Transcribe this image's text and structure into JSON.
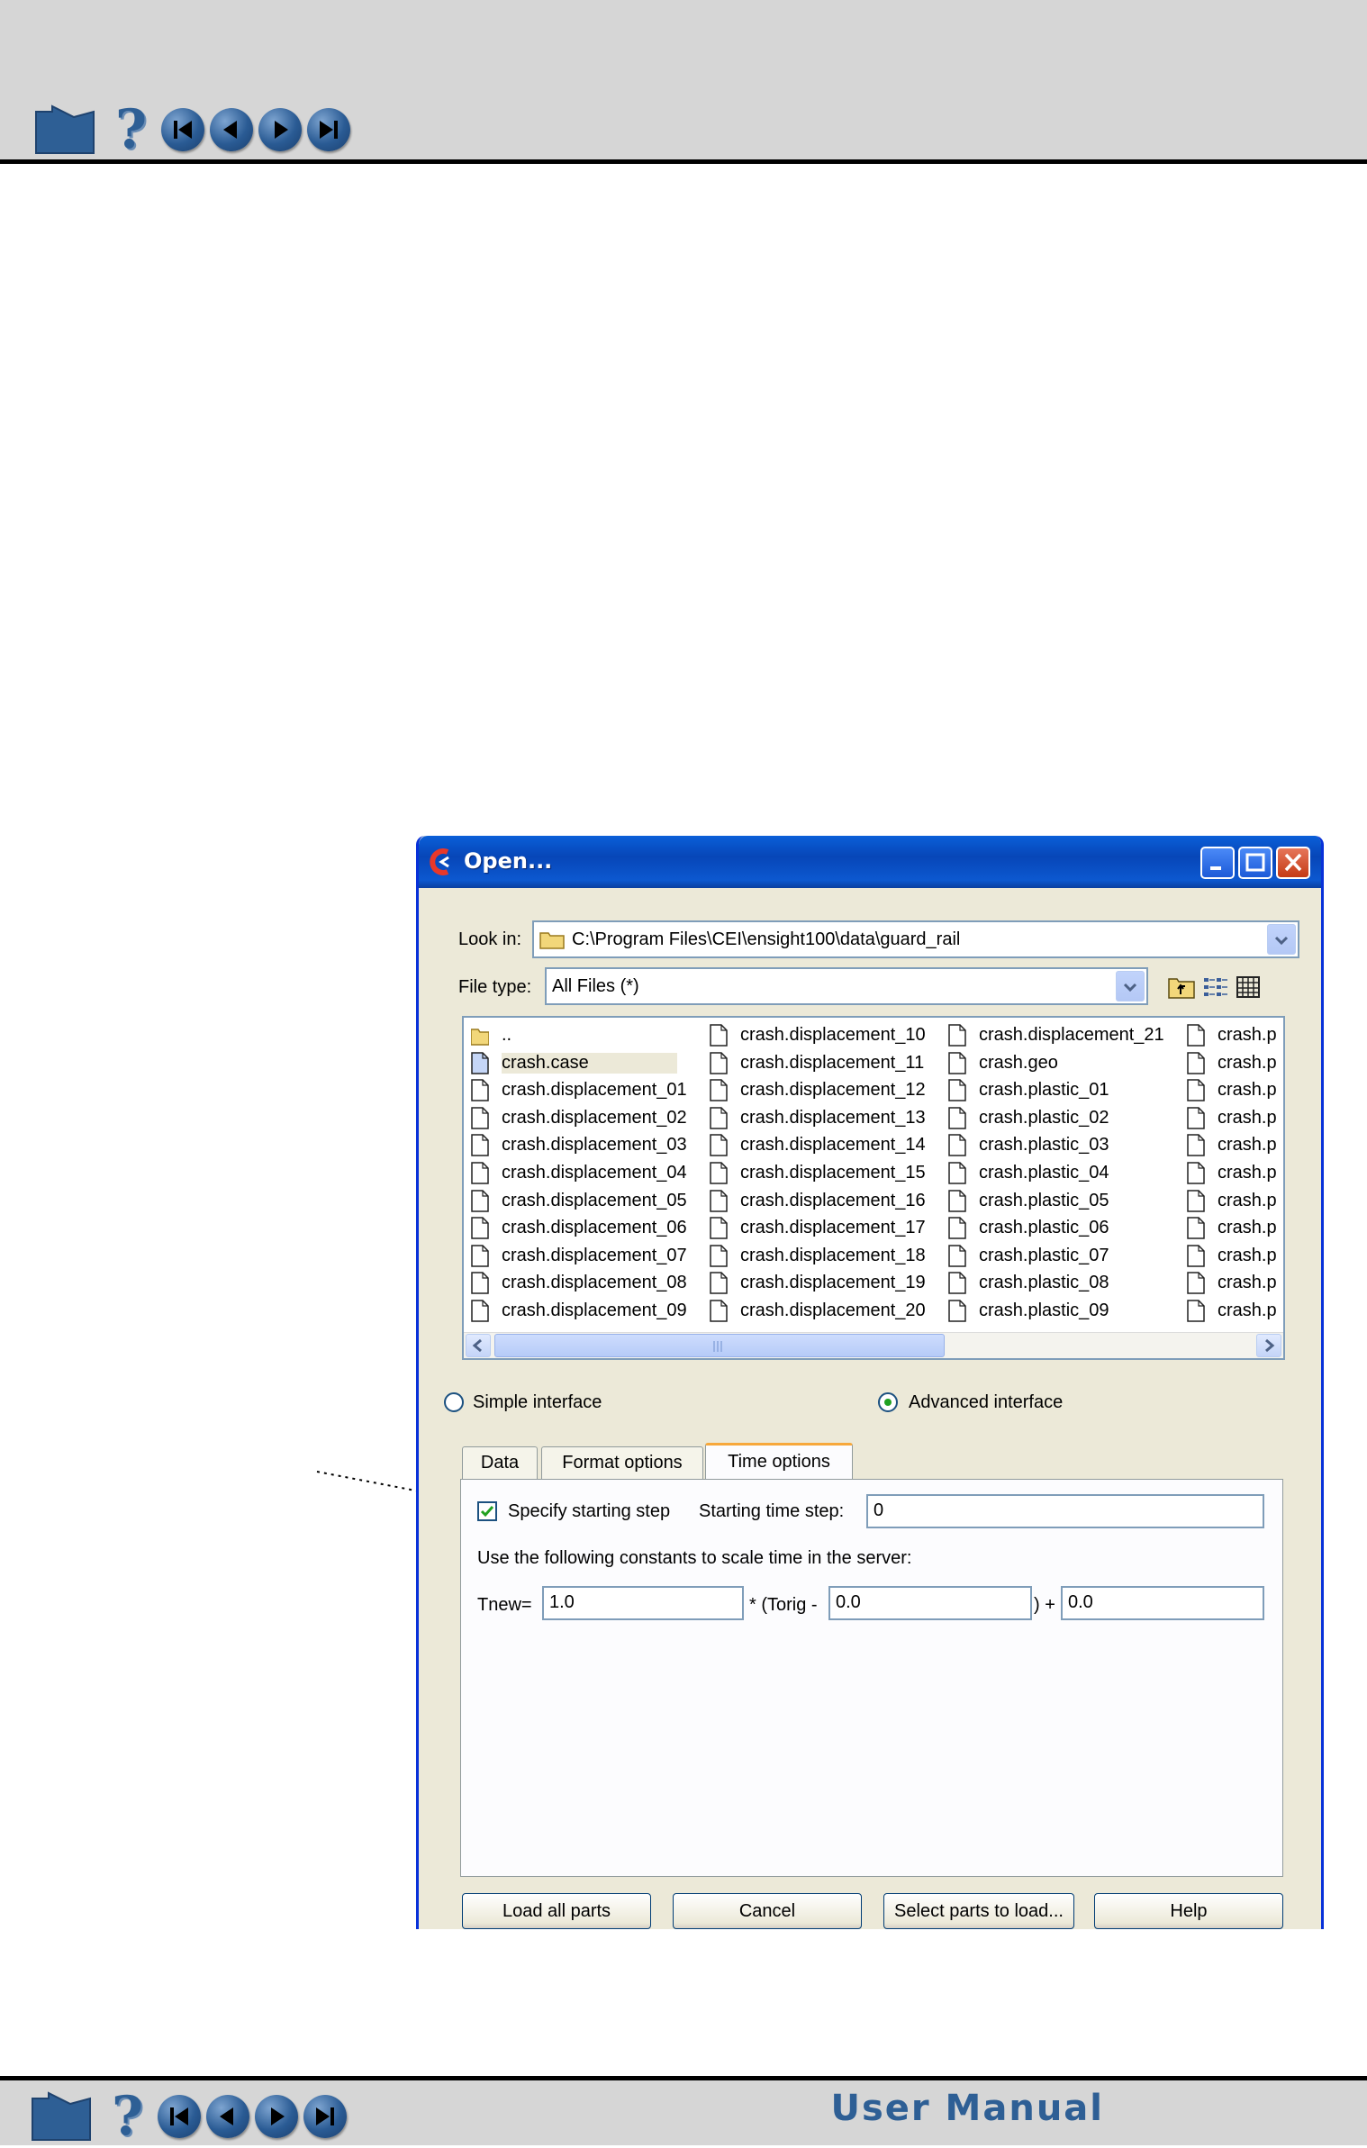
{
  "nav": {
    "home": "home-icon",
    "help": "?",
    "first": "first-page-icon",
    "prev": "previous-page-icon",
    "next": "next-page-icon",
    "last": "last-page-icon"
  },
  "footer": {
    "title": "User Manual"
  },
  "dialog": {
    "title": "Open...",
    "look_in_label": "Look in:",
    "look_in_value": "C:\\Program Files\\CEI\\ensight100\\data\\guard_rail",
    "file_type_label": "File type:",
    "file_type_value": "All Files (*)",
    "files": [
      [
        {
          "name": "..",
          "icon": "folder"
        },
        {
          "name": "crash.case",
          "icon": "file-selected"
        },
        {
          "name": "crash.displacement_01",
          "icon": "file"
        },
        {
          "name": "crash.displacement_02",
          "icon": "file"
        },
        {
          "name": "crash.displacement_03",
          "icon": "file"
        },
        {
          "name": "crash.displacement_04",
          "icon": "file"
        },
        {
          "name": "crash.displacement_05",
          "icon": "file"
        },
        {
          "name": "crash.displacement_06",
          "icon": "file"
        },
        {
          "name": "crash.displacement_07",
          "icon": "file"
        },
        {
          "name": "crash.displacement_08",
          "icon": "file"
        },
        {
          "name": "crash.displacement_09",
          "icon": "file"
        }
      ],
      [
        {
          "name": "crash.displacement_10",
          "icon": "file"
        },
        {
          "name": "crash.displacement_11",
          "icon": "file"
        },
        {
          "name": "crash.displacement_12",
          "icon": "file"
        },
        {
          "name": "crash.displacement_13",
          "icon": "file"
        },
        {
          "name": "crash.displacement_14",
          "icon": "file"
        },
        {
          "name": "crash.displacement_15",
          "icon": "file"
        },
        {
          "name": "crash.displacement_16",
          "icon": "file"
        },
        {
          "name": "crash.displacement_17",
          "icon": "file"
        },
        {
          "name": "crash.displacement_18",
          "icon": "file"
        },
        {
          "name": "crash.displacement_19",
          "icon": "file"
        },
        {
          "name": "crash.displacement_20",
          "icon": "file"
        }
      ],
      [
        {
          "name": "crash.displacement_21",
          "icon": "file"
        },
        {
          "name": "crash.geo",
          "icon": "file"
        },
        {
          "name": "crash.plastic_01",
          "icon": "file"
        },
        {
          "name": "crash.plastic_02",
          "icon": "file"
        },
        {
          "name": "crash.plastic_03",
          "icon": "file"
        },
        {
          "name": "crash.plastic_04",
          "icon": "file"
        },
        {
          "name": "crash.plastic_05",
          "icon": "file"
        },
        {
          "name": "crash.plastic_06",
          "icon": "file"
        },
        {
          "name": "crash.plastic_07",
          "icon": "file"
        },
        {
          "name": "crash.plastic_08",
          "icon": "file"
        },
        {
          "name": "crash.plastic_09",
          "icon": "file"
        }
      ],
      [
        {
          "name": "crash.p",
          "icon": "file"
        },
        {
          "name": "crash.p",
          "icon": "file"
        },
        {
          "name": "crash.p",
          "icon": "file"
        },
        {
          "name": "crash.p",
          "icon": "file"
        },
        {
          "name": "crash.p",
          "icon": "file"
        },
        {
          "name": "crash.p",
          "icon": "file"
        },
        {
          "name": "crash.p",
          "icon": "file"
        },
        {
          "name": "crash.p",
          "icon": "file"
        },
        {
          "name": "crash.p",
          "icon": "file"
        },
        {
          "name": "crash.p",
          "icon": "file"
        },
        {
          "name": "crash.p",
          "icon": "file"
        }
      ]
    ],
    "simple_label": "Simple interface",
    "advanced_label": "Advanced interface",
    "interface_selected": "advanced",
    "tabs": [
      "Data",
      "Format options",
      "Time options"
    ],
    "active_tab": "Time options",
    "time": {
      "specify_label": "Specify starting step",
      "specify_checked": true,
      "start_label": "Starting time step:",
      "start_value": "0",
      "scale_text": "Use the following constants to scale time in the server:",
      "tnew_label": "Tnew=",
      "tnew_value": "1.0",
      "torig_label": "* (Torig -",
      "torig_value": "0.0",
      "plus_label": ") +",
      "plus_value": "0.0"
    },
    "buttons": {
      "load_all": "Load all parts",
      "cancel": "Cancel",
      "select_parts": "Select parts to load...",
      "help": "Help"
    }
  },
  "colors": {
    "nav_blue": "#2e5f95",
    "title_blue": "#0746b8",
    "tab_accent": "#f7a83b"
  }
}
